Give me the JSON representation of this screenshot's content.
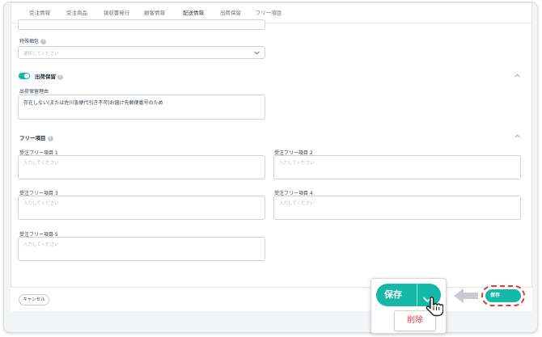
{
  "tabs": [
    {
      "label": "受注情報"
    },
    {
      "label": "受注商品"
    },
    {
      "label": "領収書発行"
    },
    {
      "label": "顧客情報"
    },
    {
      "label": "配送情報"
    },
    {
      "label": "出荷保留"
    },
    {
      "label": "フリー項目"
    }
  ],
  "active_tab": "配送情報",
  "special_report": {
    "label": "特殊梱包",
    "placeholder": "選択してください"
  },
  "shipping_hold": {
    "title": "出荷保留",
    "toggle_on": true,
    "reason_label": "出荷保留理由",
    "reason_value": "存在しない(または佐川急便代引き不可)お届け先郵便番号のため"
  },
  "free_items": {
    "title": "フリー項目",
    "fields": [
      {
        "label": "受注フリー項目 1",
        "placeholder": "入力してください"
      },
      {
        "label": "受注フリー項目 2",
        "placeholder": "入力してください"
      },
      {
        "label": "受注フリー項目 3",
        "placeholder": "入力してください"
      },
      {
        "label": "受注フリー項目 4",
        "placeholder": "入力してください"
      },
      {
        "label": "受注フリー項目 5",
        "placeholder": "入力してください"
      }
    ]
  },
  "footer": {
    "cancel_label": "キャンセル"
  },
  "zoom": {
    "save_label": "保存",
    "delete_label": "削除"
  },
  "small_save_label": "保存",
  "colors": {
    "accent": "#14b8a6",
    "highlight": "#e03a3a",
    "danger": "#e0464a"
  }
}
